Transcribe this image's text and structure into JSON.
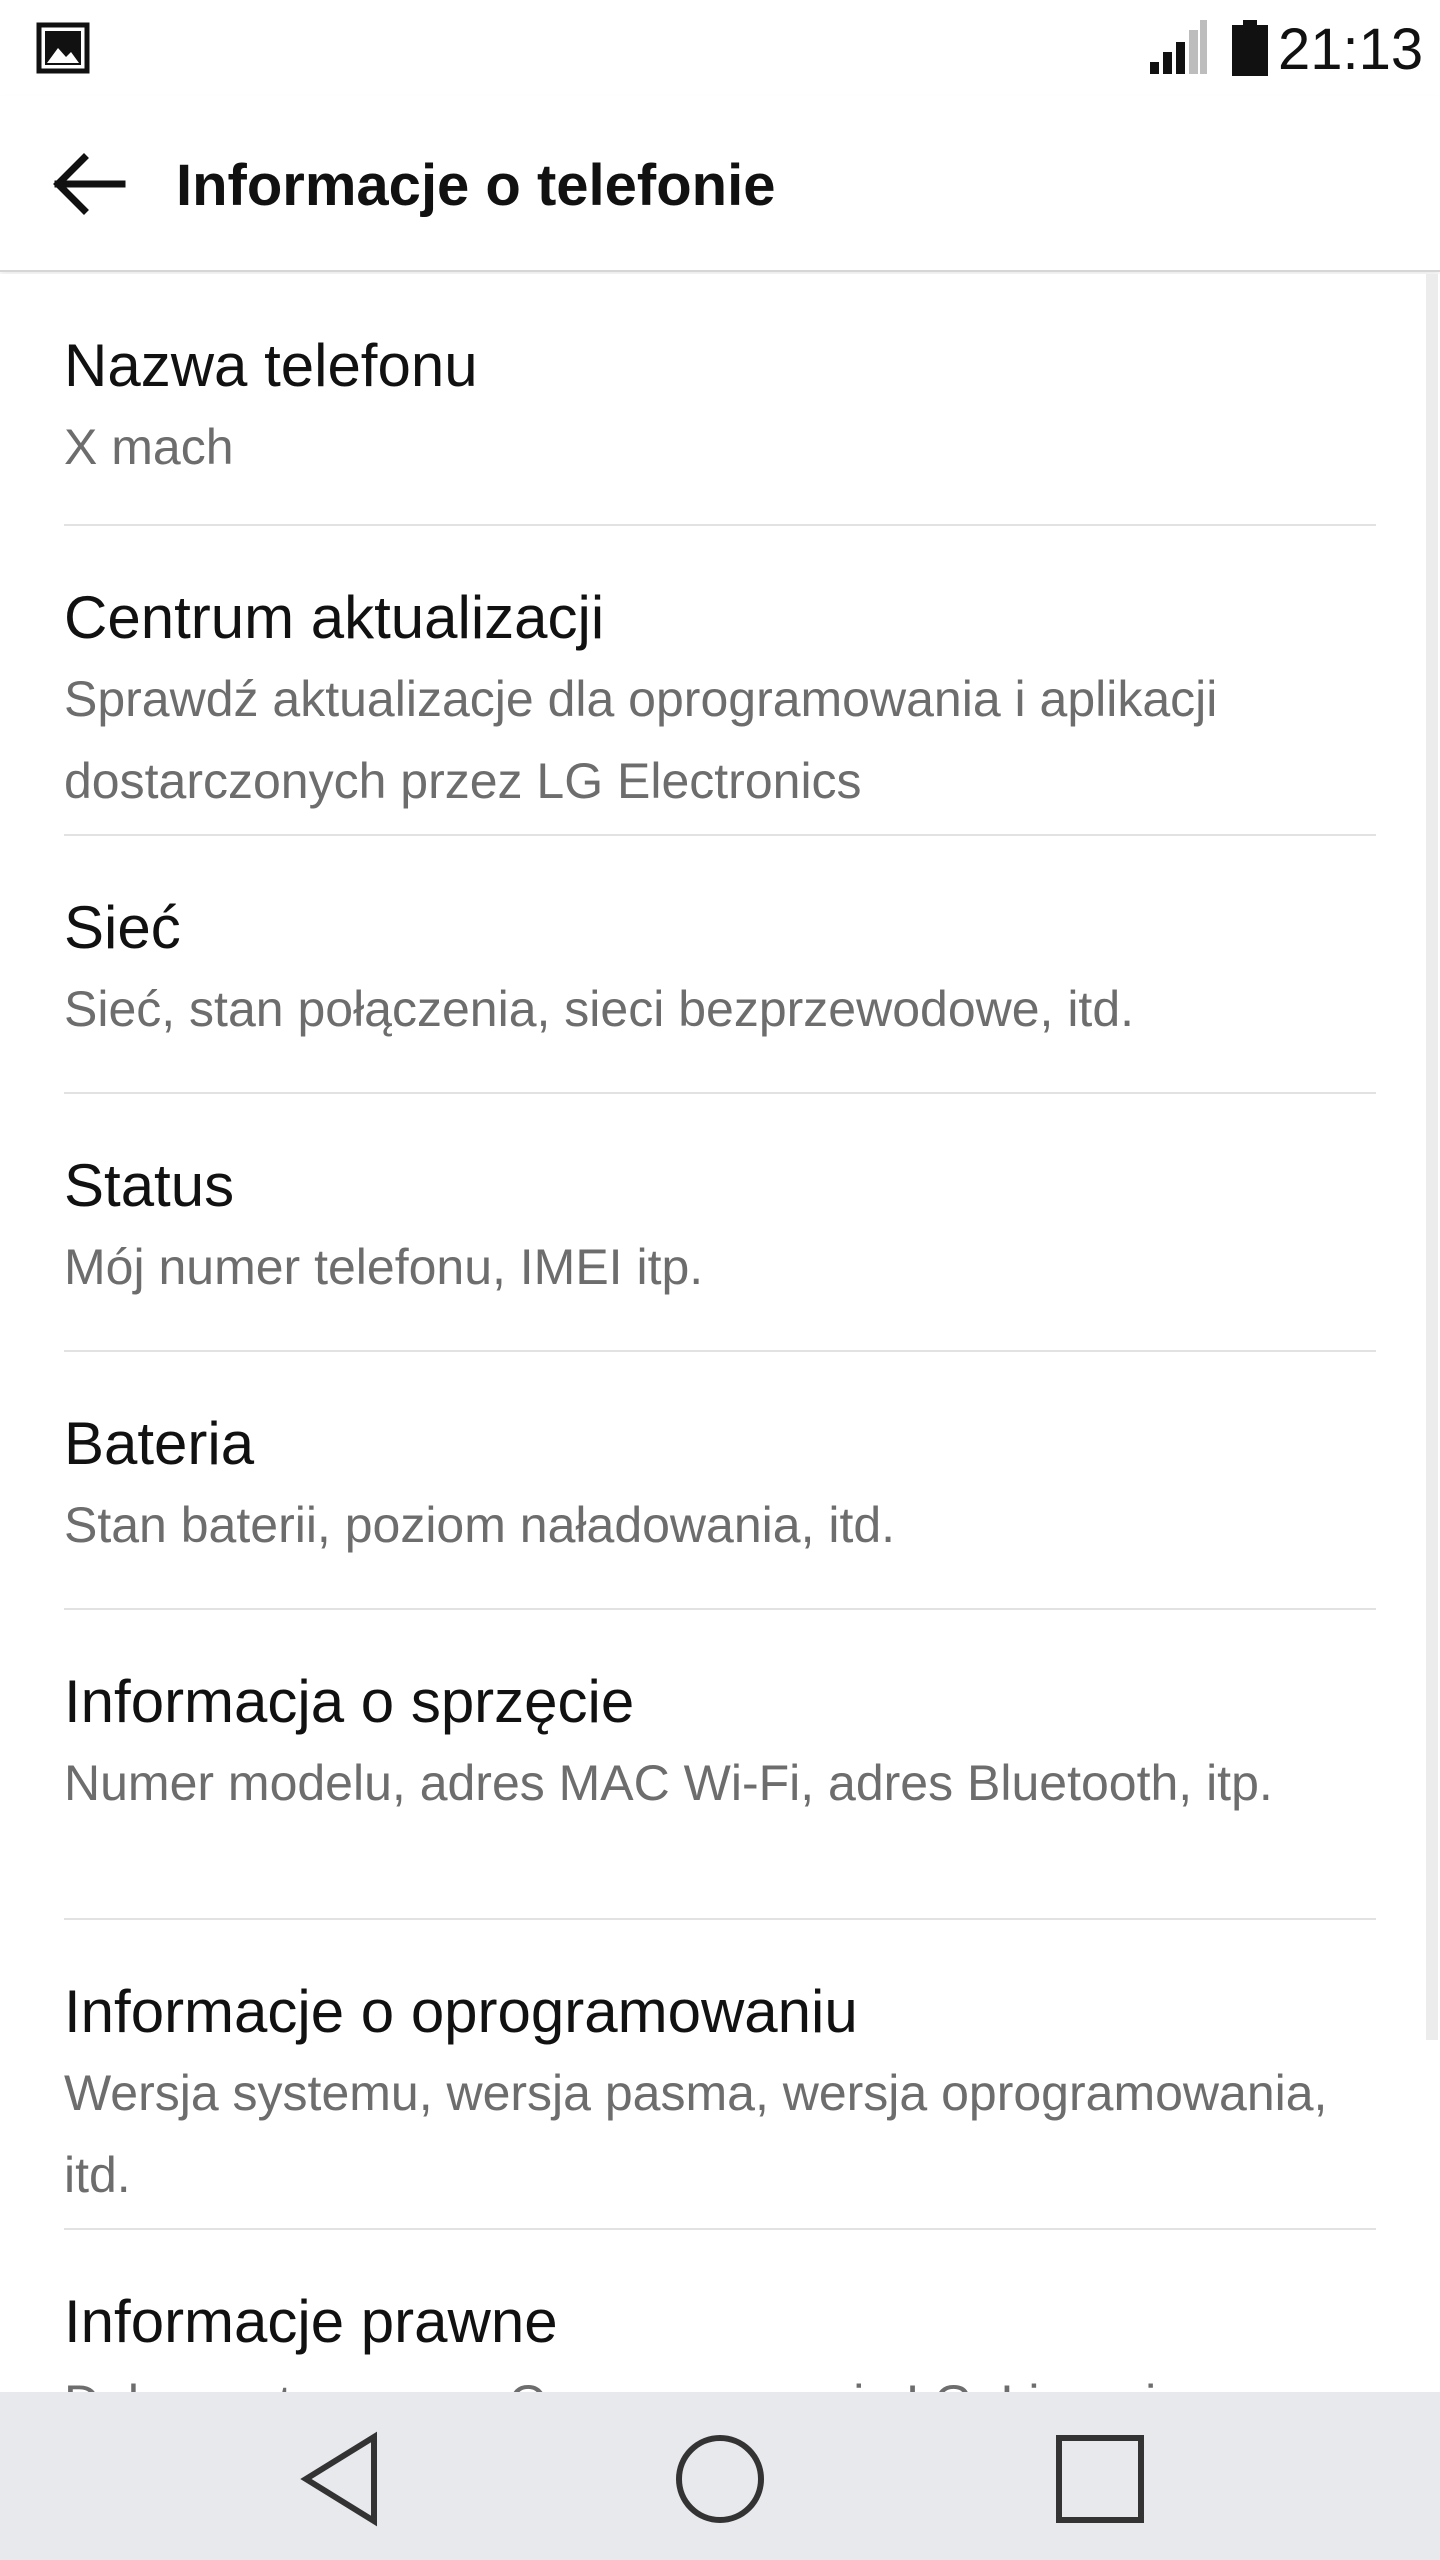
{
  "status_bar": {
    "time": "21:13",
    "icons": [
      "gallery-icon",
      "signal-icon",
      "battery-icon"
    ]
  },
  "app_bar": {
    "title": "Informacje o telefonie",
    "back_icon": "arrow-back-icon"
  },
  "items": [
    {
      "title": "Nazwa telefonu",
      "subtitle": "X mach"
    },
    {
      "title": "Centrum aktualizacji",
      "subtitle": "Sprawdź aktualizacje dla oprogramowania i aplikacji dostarczonych przez LG Electronics"
    },
    {
      "title": "Sieć",
      "subtitle": "Sieć, stan połączenia, sieci bezprzewodowe, itd."
    },
    {
      "title": "Status",
      "subtitle": "Mój numer telefonu, IMEI itp."
    },
    {
      "title": "Bateria",
      "subtitle": "Stan baterii, poziom naładowania, itd."
    },
    {
      "title": "Informacja o sprzęcie",
      "subtitle": "Numer modelu, adres MAC Wi-Fi, adres Bluetooth, itp."
    },
    {
      "title": "Informacje o oprogramowaniu",
      "subtitle": "Wersja systemu, wersja pasma, wersja oprogramowania, itd."
    },
    {
      "title": "Informacje prawne",
      "subtitle": "Dokumenty prawne Oprogramowania LG, Licencje"
    }
  ],
  "nav_bar": {
    "icons": [
      "back-triangle-icon",
      "home-circle-icon",
      "recents-square-icon"
    ]
  },
  "colors": {
    "title_text": "#111111",
    "subtitle_text": "#6d6d6d",
    "divider": "#e2e2e2",
    "nav_bar_bg": "#e8e9ed"
  }
}
